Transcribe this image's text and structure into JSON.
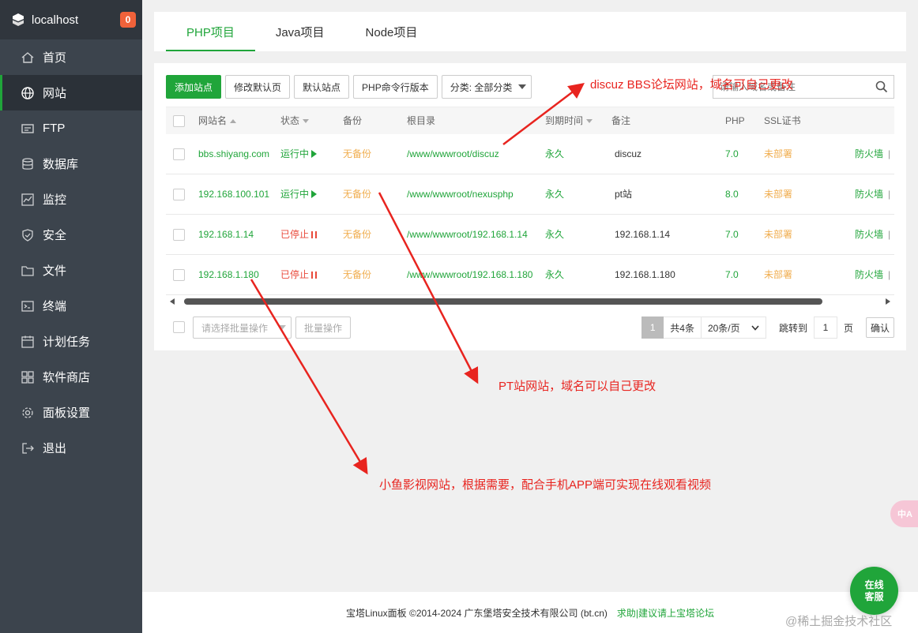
{
  "sidebar": {
    "hostname": "localhost",
    "badge": "0",
    "items": [
      {
        "label": "首页",
        "icon": "home-icon"
      },
      {
        "label": "网站",
        "icon": "globe-icon",
        "active": true
      },
      {
        "label": "FTP",
        "icon": "ftp-icon"
      },
      {
        "label": "数据库",
        "icon": "database-icon"
      },
      {
        "label": "监控",
        "icon": "monitor-icon"
      },
      {
        "label": "安全",
        "icon": "shield-icon"
      },
      {
        "label": "文件",
        "icon": "folder-icon"
      },
      {
        "label": "终端",
        "icon": "terminal-icon"
      },
      {
        "label": "计划任务",
        "icon": "calendar-icon"
      },
      {
        "label": "软件商店",
        "icon": "apps-icon"
      },
      {
        "label": "面板设置",
        "icon": "gear-icon"
      },
      {
        "label": "退出",
        "icon": "logout-icon"
      }
    ]
  },
  "tabs": [
    "PHP项目",
    "Java项目",
    "Node项目"
  ],
  "toolbar": {
    "add_site": "添加站点",
    "edit_default_page": "修改默认页",
    "default_site": "默认站点",
    "php_cli_version": "PHP命令行版本",
    "category": "分类: 全部分类"
  },
  "search": {
    "placeholder": "请输入域名或备注"
  },
  "table": {
    "headers": {
      "name": "网站名",
      "status": "状态",
      "backup": "备份",
      "root": "根目录",
      "expire": "到期时间",
      "remark": "备注",
      "php": "PHP",
      "ssl": "SSL证书"
    },
    "rows": [
      {
        "name": "bbs.shiyang.com",
        "status": "运行中",
        "running": true,
        "backup": "无备份",
        "root": "/www/wwwroot/discuz",
        "expire": "永久",
        "remark": "discuz",
        "php": "7.0",
        "ssl": "未部署",
        "action": "防火墙"
      },
      {
        "name": "192.168.100.101",
        "status": "运行中",
        "running": true,
        "backup": "无备份",
        "root": "/www/wwwroot/nexusphp",
        "expire": "永久",
        "remark": "pt站",
        "php": "8.0",
        "ssl": "未部署",
        "action": "防火墙"
      },
      {
        "name": "192.168.1.14",
        "status": "已停止",
        "running": false,
        "backup": "无备份",
        "root": "/www/wwwroot/192.168.1.14",
        "expire": "永久",
        "remark": "192.168.1.14",
        "php": "7.0",
        "ssl": "未部署",
        "action": "防火墙"
      },
      {
        "name": "192.168.1.180",
        "status": "已停止",
        "running": false,
        "backup": "无备份",
        "root": "/www/wwwroot/192.168.1.180",
        "expire": "永久",
        "remark": "192.168.1.180",
        "php": "7.0",
        "ssl": "未部署",
        "action": "防火墙"
      }
    ]
  },
  "batch": {
    "select_placeholder": "请选择批量操作",
    "button": "批量操作"
  },
  "pager": {
    "current": "1",
    "total": "共4条",
    "per_page": "20条/页",
    "jump_label": "跳转到",
    "jump_value": "1",
    "page_unit": "页",
    "confirm": "确认"
  },
  "annotations": {
    "discuz": "discuz BBS论坛网站，域名可自己更改",
    "pt": "PT站网站，域名可以自己更改",
    "fish": "小鱼影视网站，根据需要，配合手机APP端可实现在线观看视频"
  },
  "footer": {
    "copyright": "宝塔Linux面板 ©2014-2024 广东堡塔安全技术有限公司 (bt.cn)",
    "link": "求助|建议请上宝塔论坛"
  },
  "fab": {
    "line1": "在线",
    "line2": "客服"
  },
  "translate_badge": "中A",
  "watermark": "@稀土掘金技术社区",
  "colors": {
    "accent": "#20a53a",
    "sidebar": "#3c444d",
    "annotation": "#e8241f",
    "warning": "#f0ad4e",
    "stopped": "#e94a3b"
  }
}
